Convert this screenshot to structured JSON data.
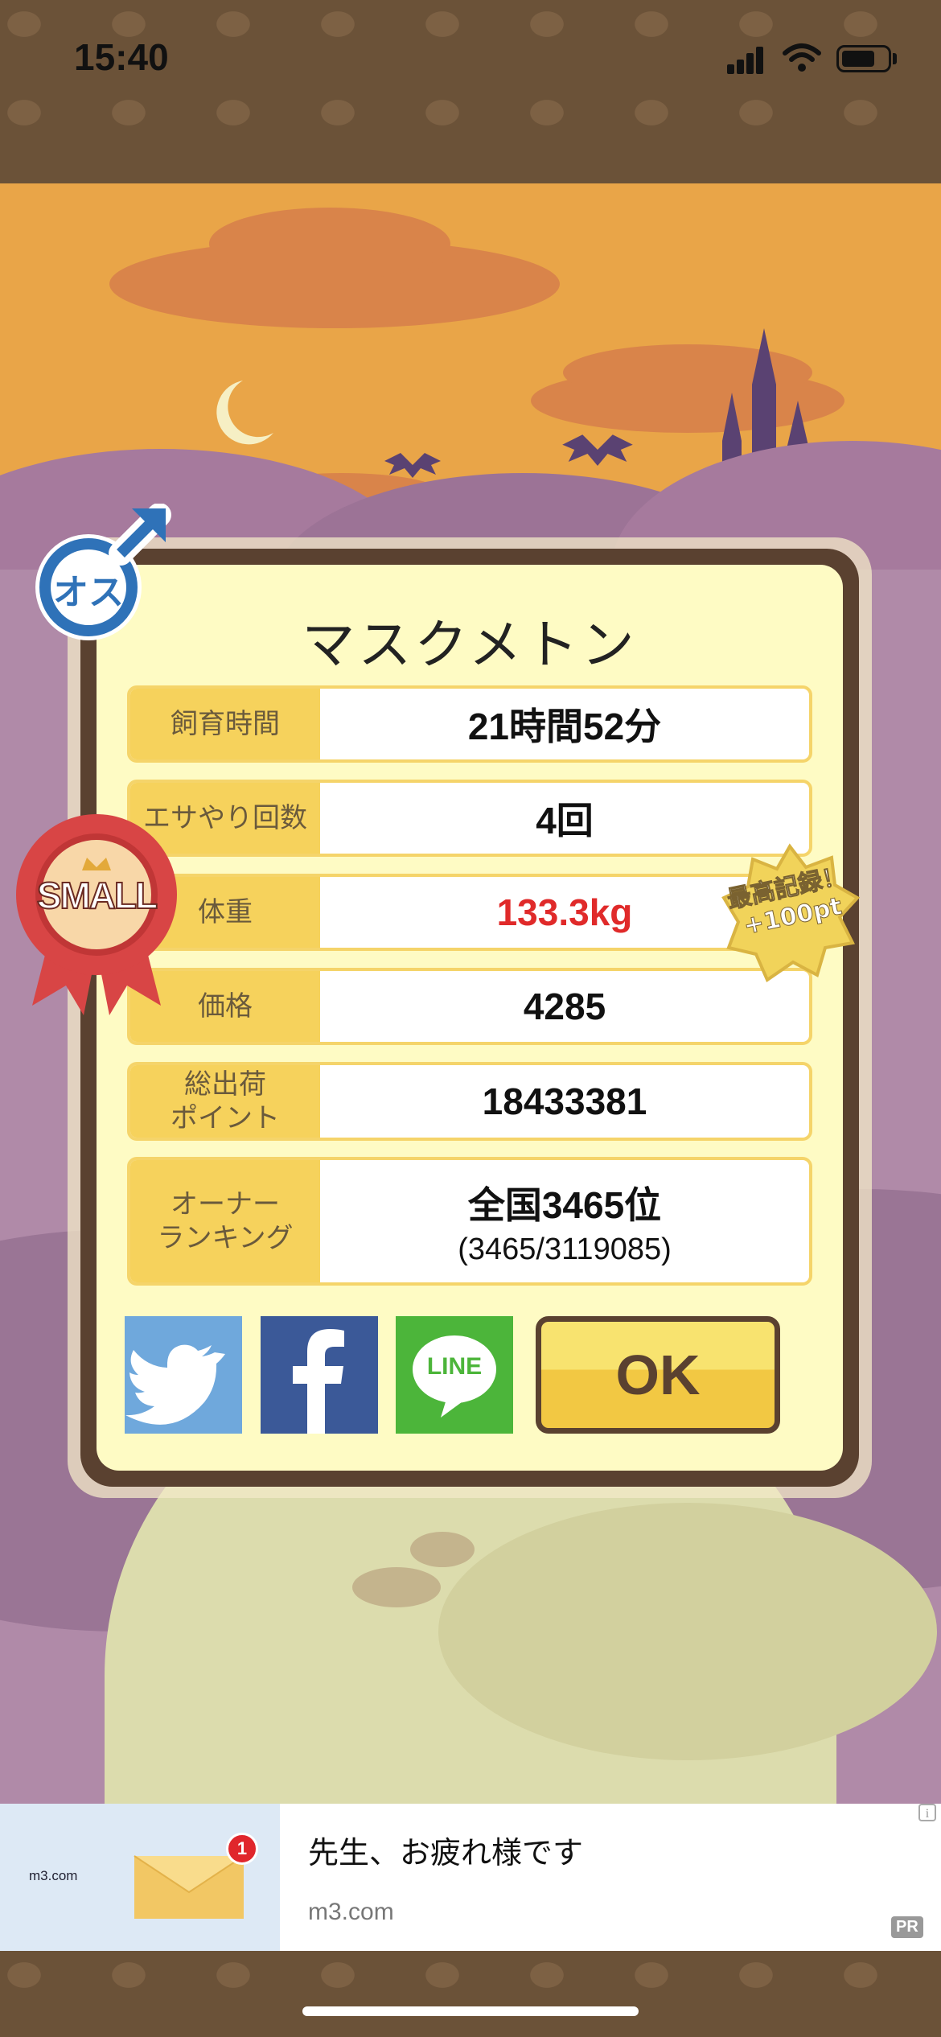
{
  "status_bar": {
    "time": "15:40"
  },
  "panel": {
    "pet_name": "マスクメトン",
    "gender_badge": "オス",
    "size_badge": "SMALL",
    "record_badge": "最高記録！+100pt",
    "rows": [
      {
        "label": "飼育時間",
        "value": "21時間52分"
      },
      {
        "label": "エサやり回数",
        "value": "4回"
      },
      {
        "label": "体重",
        "value": "133.3kg"
      },
      {
        "label": "価格",
        "value": "4285"
      },
      {
        "label": "総出荷\nポイント",
        "value": "18433381"
      },
      {
        "label": "オーナー\nランキング",
        "value": "全国3465位",
        "sub": "(3465/3119085)"
      }
    ],
    "share": {
      "line_label": "LINE"
    },
    "ok_label": "OK"
  },
  "ad": {
    "brand": "m3.com",
    "badge_count": "1",
    "title": "先生、お疲れ様です",
    "url": "m3.com",
    "pr": "PR",
    "info": "i"
  },
  "colors": {
    "panel_border": "#5a4130",
    "label_bg": "#f6d25c",
    "highlight_value": "#e02a2a",
    "twitter": "#6fa8dc",
    "facebook": "#3b5998",
    "line": "#4cb53a"
  }
}
